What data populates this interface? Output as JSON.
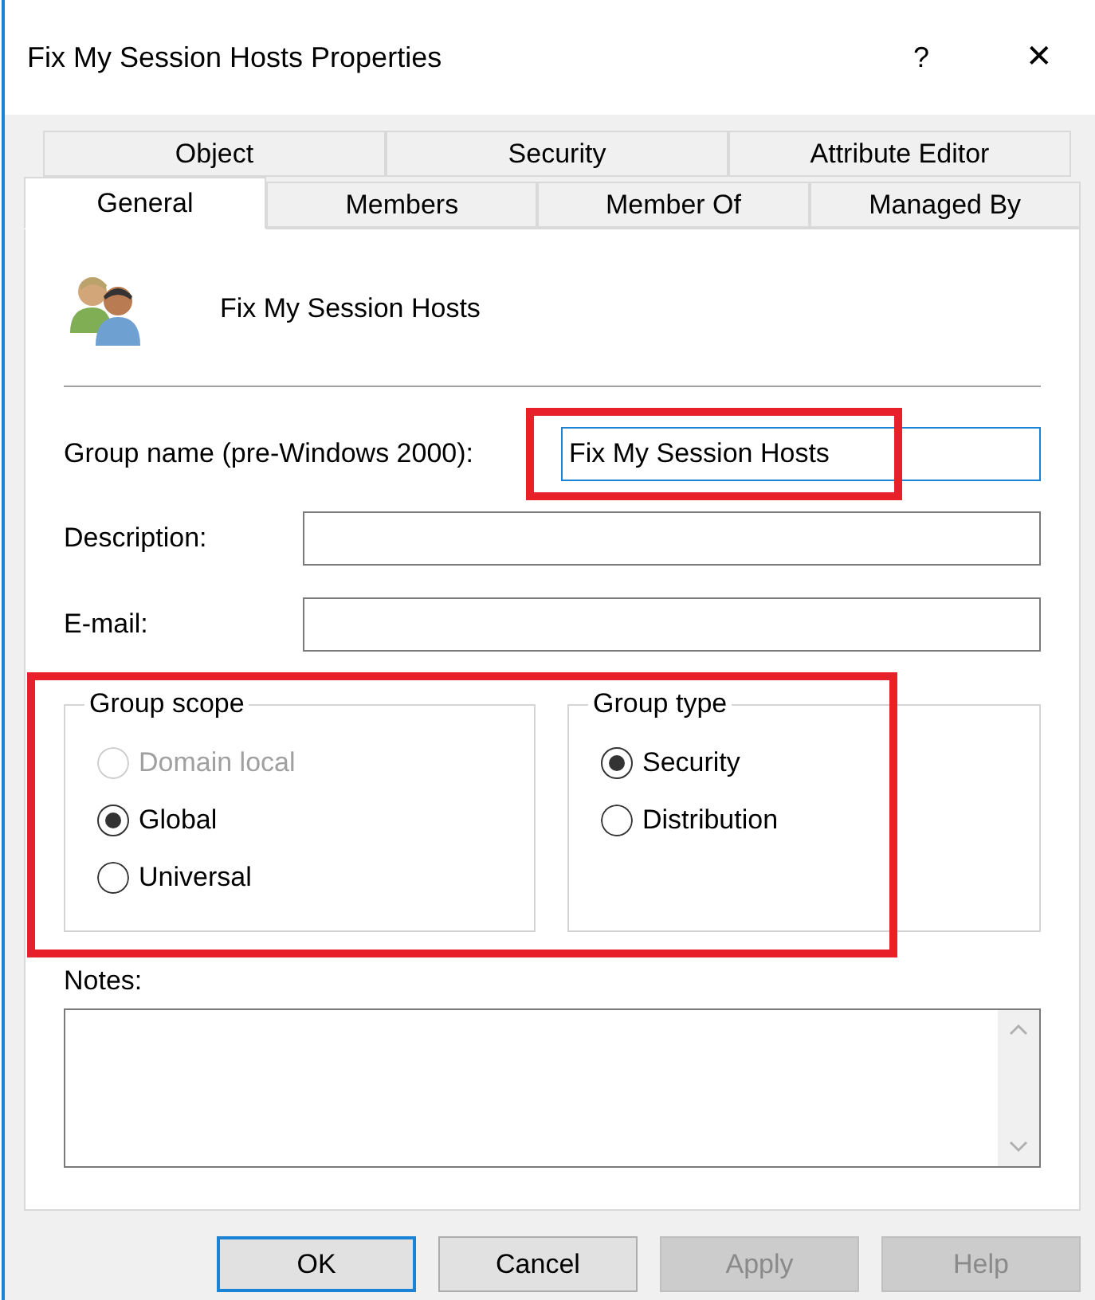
{
  "window": {
    "title": "Fix My Session Hosts Properties",
    "help": "?",
    "close": "✕"
  },
  "tab_rows": [
    [
      {
        "label": "Object",
        "selected": false
      },
      {
        "label": "Security",
        "selected": false
      },
      {
        "label": "Attribute Editor",
        "selected": false
      }
    ],
    [
      {
        "label": "General",
        "selected": true
      },
      {
        "label": "Members",
        "selected": false
      },
      {
        "label": "Member Of",
        "selected": false
      },
      {
        "label": "Managed By",
        "selected": false
      }
    ]
  ],
  "header": {
    "name": "Fix My Session Hosts"
  },
  "fields": [
    {
      "label": "Group name (pre-Windows 2000):",
      "value": "Fix My Session Hosts",
      "focused": true,
      "highlighted": true
    },
    {
      "label": "Description:",
      "focused": false,
      "highlighted": false
    },
    {
      "label": "E-mail:",
      "focused": false,
      "highlighted": false
    }
  ],
  "groups_highlighted": true,
  "group_scope": {
    "title": "Group scope",
    "options": [
      {
        "label": "Domain local",
        "selected": false,
        "disabled": true
      },
      {
        "label": "Global",
        "selected": true,
        "disabled": false
      },
      {
        "label": "Universal",
        "selected": false,
        "disabled": false
      }
    ]
  },
  "group_type": {
    "title": "Group type",
    "options": [
      {
        "label": "Security",
        "selected": true,
        "disabled": false
      },
      {
        "label": "Distribution",
        "selected": false,
        "disabled": false
      }
    ]
  },
  "notes": {
    "label": "Notes:"
  },
  "buttons": [
    {
      "label": "OK",
      "default": true,
      "disabled": false
    },
    {
      "label": "Cancel",
      "default": false,
      "disabled": false
    },
    {
      "label": "Apply",
      "default": false,
      "disabled": true
    },
    {
      "label": "Help",
      "default": false,
      "disabled": true
    }
  ]
}
